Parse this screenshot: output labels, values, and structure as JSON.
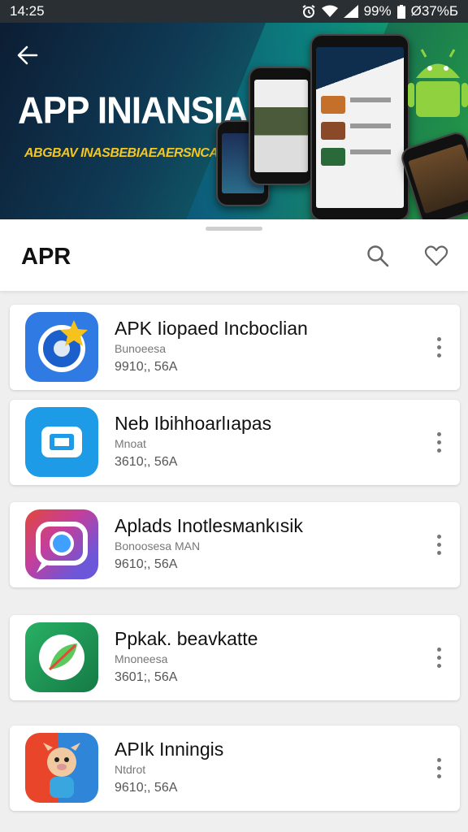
{
  "status_bar": {
    "time": "14:25",
    "battery_text": "99%",
    "extra_text": "Ø37%Б",
    "icons": [
      "alarm-icon",
      "wifi-icon",
      "signal-icon",
      "battery-icon"
    ]
  },
  "banner": {
    "title": "APP INIANSIA",
    "subtitle": "ABGBAV INASBEBIAEAERSNCAA"
  },
  "header": {
    "title": "APR",
    "icons": [
      "search-icon",
      "heart-icon"
    ]
  },
  "apps": [
    {
      "name": "APK Iiopaed Incboclian",
      "developer": "Bunoeesa",
      "meta": "9910;, 56A",
      "icon": "chat-star-icon",
      "color": "#2f7be3"
    },
    {
      "name": "Neb Ibihhoarlıapas",
      "developer": "Mnoat",
      "meta": "3610;, 56A",
      "icon": "camera-app-icon",
      "color": "#1e9be6"
    },
    {
      "name": "Aplads Inotlesмankısik",
      "developer": "Bonoosesa MAN",
      "meta": "9610;, 56A",
      "icon": "gradient-chat-icon",
      "color": "#8a4fd0"
    },
    {
      "name": "Ppkak. beavkatte",
      "developer": "Mnoneesa",
      "meta": "3601;, 56A",
      "icon": "leaf-app-icon",
      "color": "#1b9a57"
    },
    {
      "name": "APIk Inningis",
      "developer": "Ntdrot",
      "meta": "9610;, 56A",
      "icon": "cartoon-mascot-icon",
      "color": "#e04a20"
    }
  ]
}
